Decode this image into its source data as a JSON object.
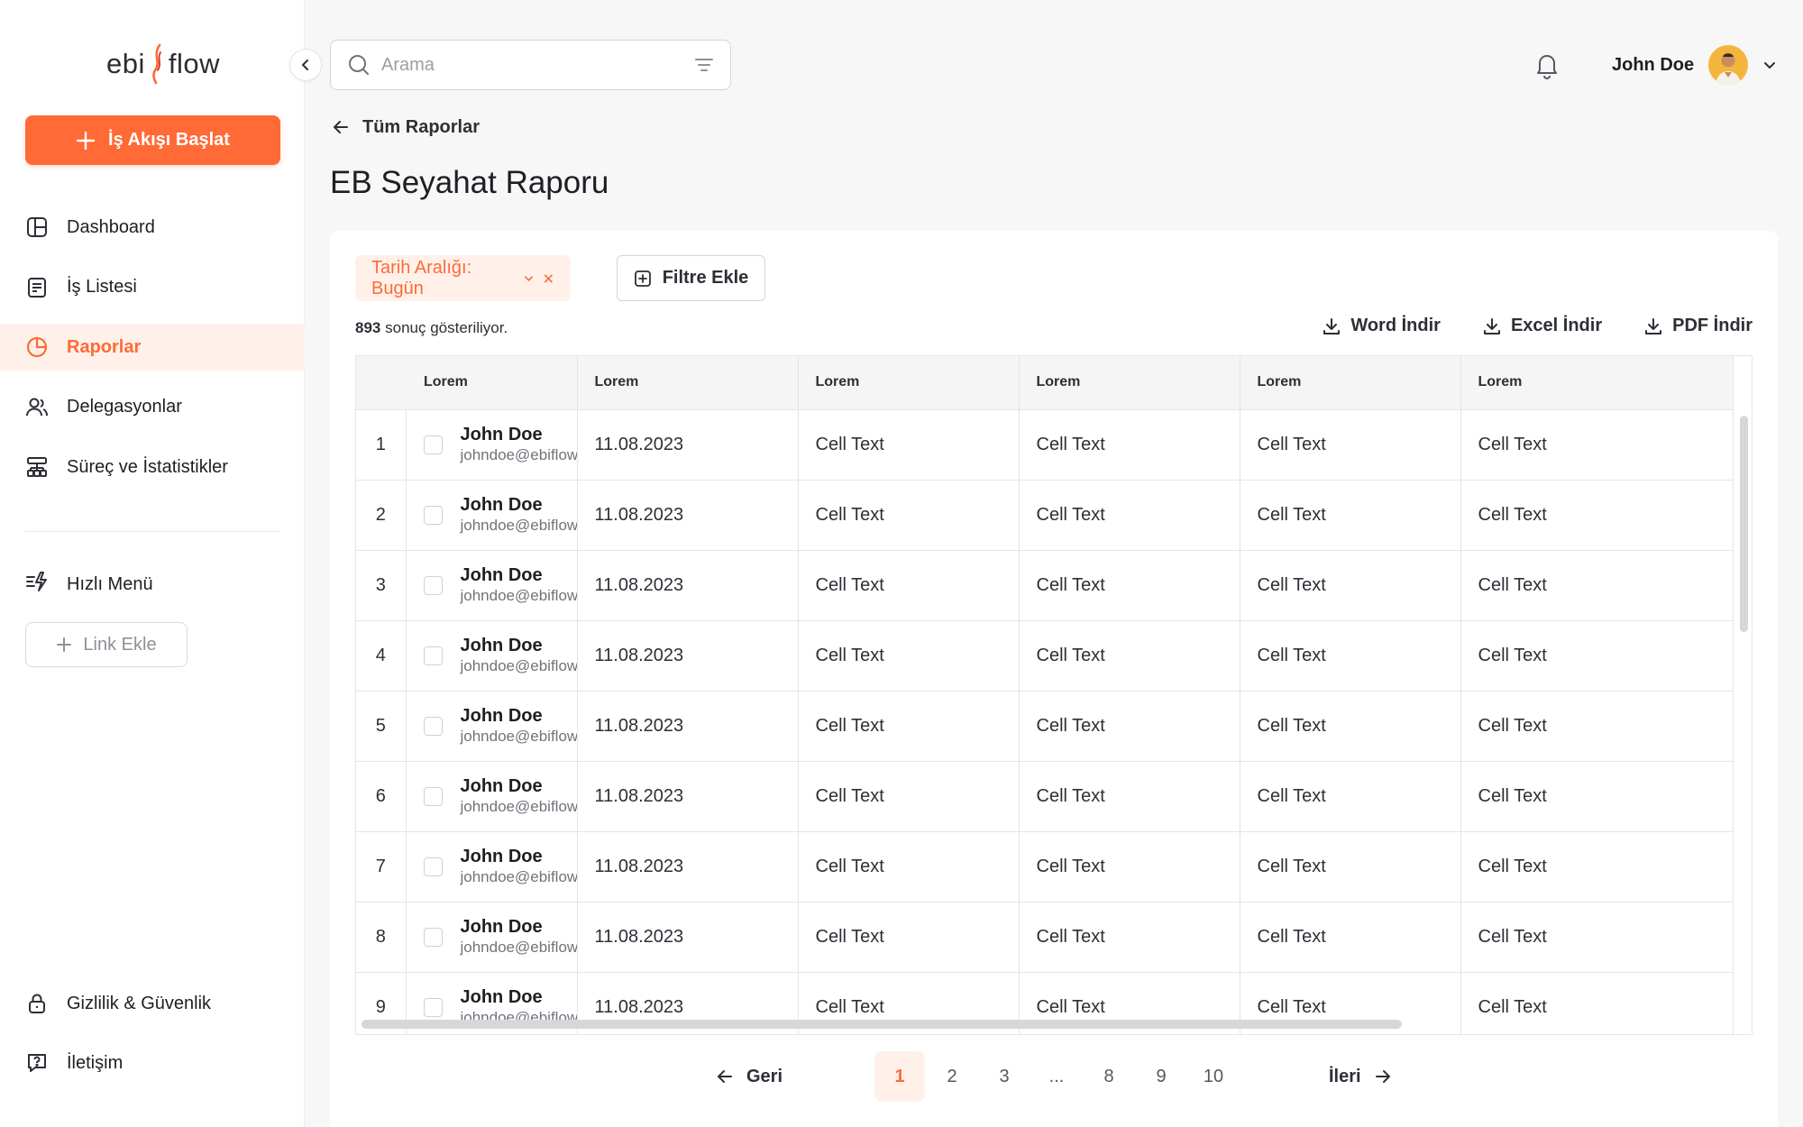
{
  "brand": {
    "name_left": "ebi",
    "name_right": "flow",
    "accent": "#ff6a36"
  },
  "sidebar": {
    "start_button": "İş Akışı Başlat",
    "items": [
      {
        "label": "Dashboard",
        "icon": "dashboard-icon",
        "active": false
      },
      {
        "label": "İş Listesi",
        "icon": "task-list-icon",
        "active": false
      },
      {
        "label": "Raporlar",
        "icon": "pie-chart-icon",
        "active": true
      },
      {
        "label": "Delegasyonlar",
        "icon": "users-icon",
        "active": false
      },
      {
        "label": "Süreç ve İstatistikler",
        "icon": "hierarchy-icon",
        "active": false
      }
    ],
    "quick_menu": "Hızlı Menü",
    "link_button": "Link Ekle",
    "bottom_items": [
      {
        "label": "Gizlilik & Güvenlik",
        "icon": "lock-icon"
      },
      {
        "label": "İletişim",
        "icon": "help-chat-icon"
      }
    ]
  },
  "header": {
    "search_placeholder": "Arama",
    "user_name": "John Doe"
  },
  "page": {
    "back_label": "Tüm Raporlar",
    "title": "EB Seyahat Raporu",
    "filter_chip": "Tarih Aralığı: Bugün",
    "add_filter": "Filtre Ekle",
    "result_count": "893",
    "result_suffix": "sonuç gösteriliyor.",
    "downloads": [
      "Word İndir",
      "Excel İndir",
      "PDF İndir"
    ]
  },
  "table": {
    "columns": [
      "Lorem",
      "Lorem",
      "Lorem",
      "Lorem",
      "Lorem",
      "Lorem"
    ],
    "rows": [
      {
        "index": "1",
        "name": "John Doe",
        "email": "johndoe@ebiflow.com",
        "date": "11.08.2023",
        "cells": [
          "Cell Text",
          "Cell Text",
          "Cell Text",
          "Cell Text"
        ]
      },
      {
        "index": "2",
        "name": "John Doe",
        "email": "johndoe@ebiflow.com",
        "date": "11.08.2023",
        "cells": [
          "Cell Text",
          "Cell Text",
          "Cell Text",
          "Cell Text"
        ]
      },
      {
        "index": "3",
        "name": "John Doe",
        "email": "johndoe@ebiflow.com",
        "date": "11.08.2023",
        "cells": [
          "Cell Text",
          "Cell Text",
          "Cell Text",
          "Cell Text"
        ]
      },
      {
        "index": "4",
        "name": "John Doe",
        "email": "johndoe@ebiflow.com",
        "date": "11.08.2023",
        "cells": [
          "Cell Text",
          "Cell Text",
          "Cell Text",
          "Cell Text"
        ]
      },
      {
        "index": "5",
        "name": "John Doe",
        "email": "johndoe@ebiflow.com",
        "date": "11.08.2023",
        "cells": [
          "Cell Text",
          "Cell Text",
          "Cell Text",
          "Cell Text"
        ]
      },
      {
        "index": "6",
        "name": "John Doe",
        "email": "johndoe@ebiflow.com",
        "date": "11.08.2023",
        "cells": [
          "Cell Text",
          "Cell Text",
          "Cell Text",
          "Cell Text"
        ]
      },
      {
        "index": "7",
        "name": "John Doe",
        "email": "johndoe@ebiflow.com",
        "date": "11.08.2023",
        "cells": [
          "Cell Text",
          "Cell Text",
          "Cell Text",
          "Cell Text"
        ]
      },
      {
        "index": "8",
        "name": "John Doe",
        "email": "johndoe@ebiflow.com",
        "date": "11.08.2023",
        "cells": [
          "Cell Text",
          "Cell Text",
          "Cell Text",
          "Cell Text"
        ]
      },
      {
        "index": "9",
        "name": "John Doe",
        "email": "johndoe@ebiflow.com",
        "date": "11.08.2023",
        "cells": [
          "Cell Text",
          "Cell Text",
          "Cell Text",
          "Cell Text"
        ]
      }
    ]
  },
  "pagination": {
    "prev": "Geri",
    "next": "İleri",
    "pages": [
      "1",
      "2",
      "3",
      "...",
      "8",
      "9",
      "10"
    ],
    "current": "1"
  }
}
